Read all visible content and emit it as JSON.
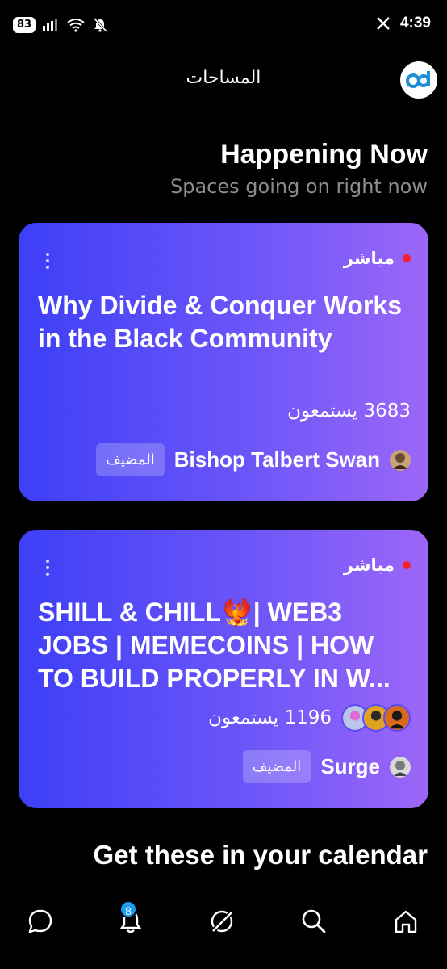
{
  "status_bar": {
    "battery": "83",
    "time": "4:39"
  },
  "header": {
    "title": "المساحات"
  },
  "section": {
    "title": "Happening Now",
    "subtitle": "Spaces going on right now"
  },
  "spaces": [
    {
      "live_label": "مباشر",
      "title": "Why Divide & Conquer Works in the Black Community",
      "listeners": "3683 يستمعون",
      "host_name": "Bishop Talbert Swan",
      "host_badge": "المضيف"
    },
    {
      "live_label": "مباشر",
      "title": "SHILL & CHILL🐦‍🔥| WEB3 JOBS | MEMECOINS | HOW TO BUILD PROPERLY IN W...",
      "listeners": "1196 يستمعون",
      "host_name": "Surge",
      "host_badge": "المضيف"
    }
  ],
  "calendar": {
    "title": "Get these in your calendar"
  },
  "bottom_nav": {
    "notifications_badge": "8"
  }
}
